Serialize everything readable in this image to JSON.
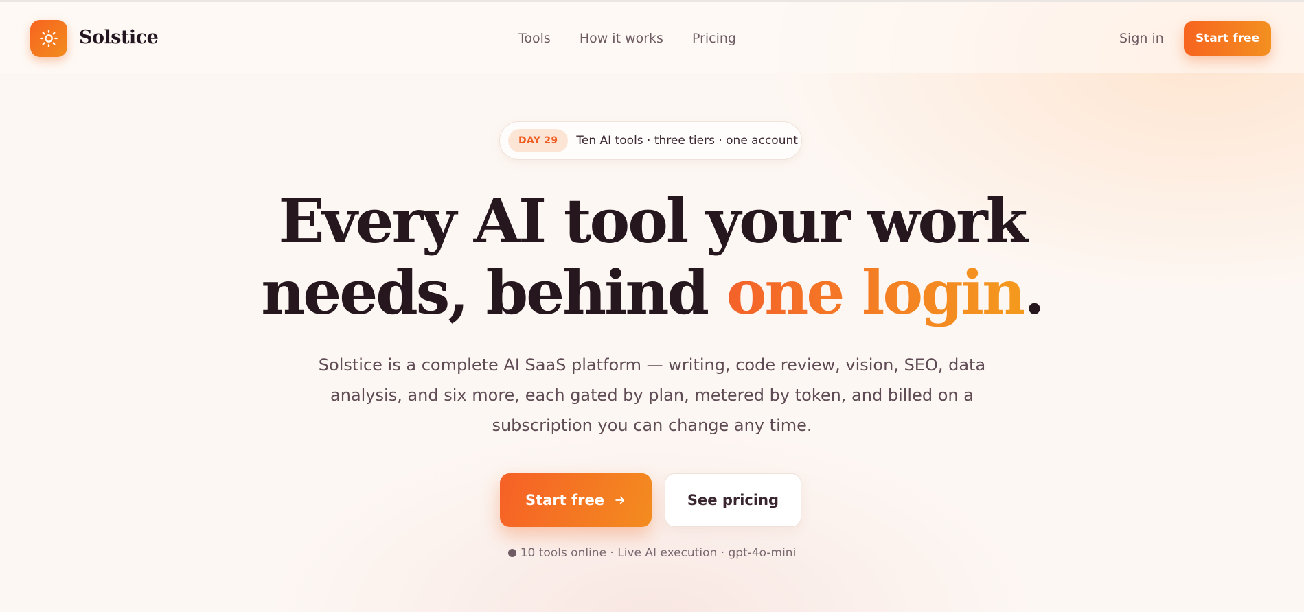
{
  "brand": {
    "name": "Solstice",
    "logo_icon": "sun-icon",
    "accent": "#f7641f",
    "accent_end": "#f39020"
  },
  "nav": {
    "links": [
      "Tools",
      "How it works",
      "Pricing"
    ],
    "sign_in": "Sign in",
    "cta": "Start free"
  },
  "pill": {
    "badge": "DAY 29",
    "text": "Ten AI tools · three tiers · one account"
  },
  "headline": {
    "line1": "Every AI tool your work",
    "line2_plain": "needs, behind ",
    "line2_accent": "one login",
    "line2_end": "."
  },
  "subtext": "Solstice is a complete AI SaaS platform — writing, code review, vision, SEO, data analysis, and six more, each gated by plan, metered by token, and billed on a subscription you can change any time.",
  "cta": {
    "primary": "Start free",
    "primary_icon": "arrow-right-icon",
    "secondary": "See pricing"
  },
  "status": {
    "text": "10 tools online · Live AI execution · gpt-4o-mini"
  }
}
